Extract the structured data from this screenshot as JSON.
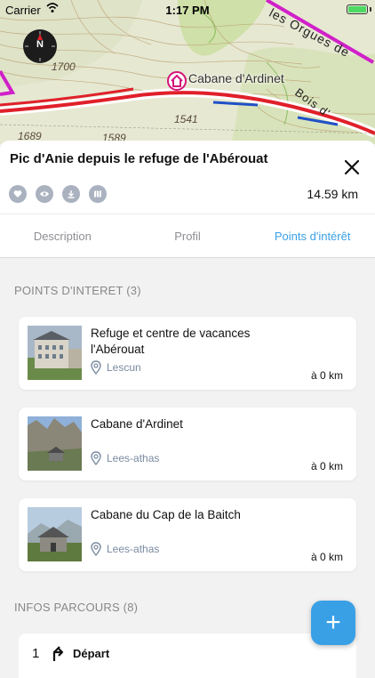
{
  "status_bar": {
    "carrier": "Carrier",
    "time": "1:17 PM",
    "battery_level": 1.0
  },
  "map": {
    "compass_label": "N",
    "poi_label": "Cabane d'Ardinet",
    "ridge_label": "les Orgues de",
    "bois_label": "Bois d'",
    "elevations": [
      "1700",
      "1541",
      "1689",
      "1589"
    ],
    "colors": {
      "route": "#e0202a",
      "route_alt": "#2050c8",
      "trail": "#d020c8"
    }
  },
  "header": {
    "title": "Pic d'Anie depuis le refuge de l'Abérouat",
    "distance": "14.59 km",
    "actions": [
      "heart-icon",
      "eye-icon",
      "download-icon",
      "map-icon"
    ]
  },
  "tabs": [
    {
      "label": "Description",
      "active": false
    },
    {
      "label": "Profil",
      "active": false
    },
    {
      "label": "Points d'intérêt",
      "active": true
    }
  ],
  "points": {
    "title": "POINTS D'INTERET (3)",
    "items": [
      {
        "name": "Refuge et centre de vacances l'Abérouat",
        "place": "Lescun",
        "distance": "à 0 km"
      },
      {
        "name": "Cabane d'Ardinet",
        "place": "Lees-athas",
        "distance": "à 0 km"
      },
      {
        "name": "Cabane du Cap de la Baitch",
        "place": "Lees-athas",
        "distance": "à 0 km"
      }
    ]
  },
  "route_info": {
    "title": "INFOS PARCOURS (8)",
    "steps": [
      {
        "number": "1",
        "label": "Départ"
      }
    ]
  },
  "fab": {
    "label": "+"
  },
  "colors": {
    "accent": "#3aa0e6",
    "tab_inactive": "#8e8e93",
    "place_text": "#7a8aa0"
  }
}
